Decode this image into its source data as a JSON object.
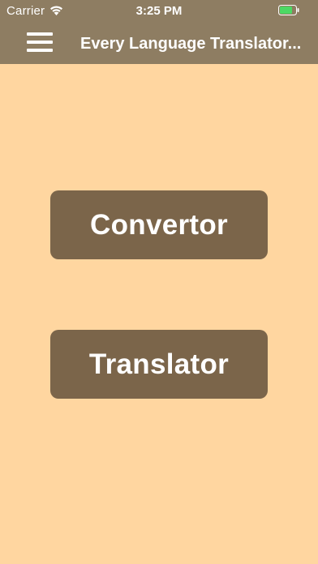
{
  "status_bar": {
    "carrier": "Carrier",
    "time": "3:25 PM",
    "wifi_icon": "wifi-icon",
    "battery_icon": "battery-icon",
    "battery_color": "#4CD964"
  },
  "nav_bar": {
    "menu_icon": "hamburger-menu-icon",
    "title": "Every Language Translator..."
  },
  "main": {
    "buttons": [
      {
        "label": "Convertor"
      },
      {
        "label": "Translator"
      }
    ]
  },
  "colors": {
    "header": "#8E7D62",
    "background": "#FFD6A0",
    "button": "#7B654A",
    "text": "#FFFFFF"
  }
}
